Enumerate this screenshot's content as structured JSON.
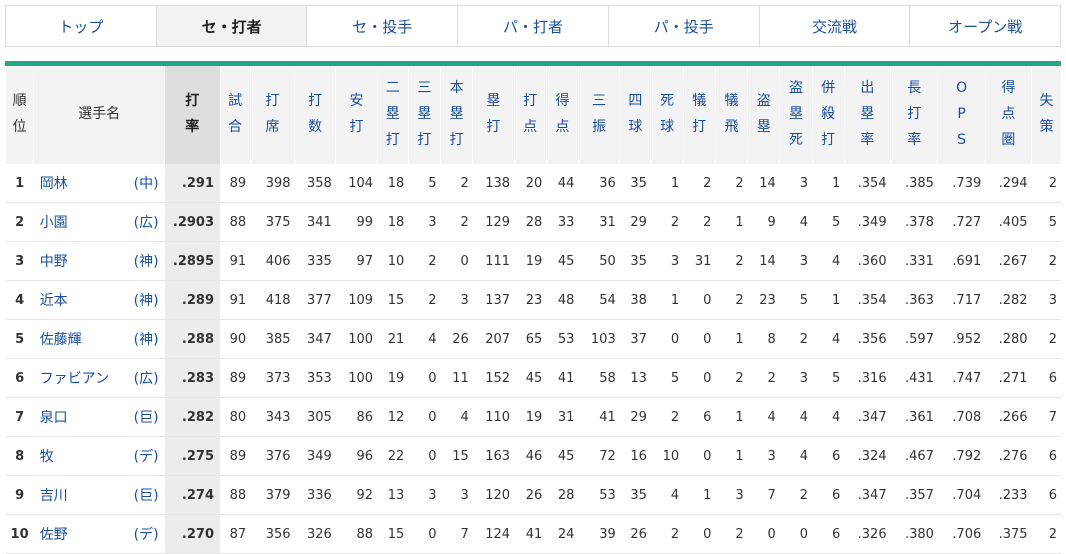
{
  "tabs": [
    {
      "label": "トップ",
      "active": false
    },
    {
      "label": "セ・打者",
      "active": true
    },
    {
      "label": "セ・投手",
      "active": false
    },
    {
      "label": "パ・打者",
      "active": false
    },
    {
      "label": "パ・投手",
      "active": false
    },
    {
      "label": "交流戦",
      "active": false
    },
    {
      "label": "オープン戦",
      "active": false
    }
  ],
  "columns": {
    "rank": "順位",
    "player": "選手名",
    "avg": "打率",
    "games": "試合",
    "pa": "打席",
    "ab": "打数",
    "h": "安打",
    "d": "二塁打",
    "t": "三塁打",
    "hr": "本塁打",
    "tb": "塁打",
    "rbi": "打点",
    "r": "得点",
    "so": "三振",
    "bb": "四球",
    "hbp": "死球",
    "sh": "犠打",
    "sf": "犠飛",
    "sb": "盗塁",
    "cs": "盗塁死",
    "gdp": "併殺打",
    "obp": "出塁率",
    "slg": "長打率",
    "ops": "OPS",
    "risp": "得点圏",
    "e": "失策"
  },
  "rows": [
    {
      "rank": "1",
      "name": "岡林",
      "team": "(中)",
      "avg": ".291",
      "g": "89",
      "pa": "398",
      "ab": "358",
      "h": "104",
      "d": "18",
      "t": "5",
      "hr": "2",
      "tb": "138",
      "rbi": "20",
      "r": "44",
      "so": "36",
      "bb": "35",
      "hbp": "1",
      "sh": "2",
      "sf": "2",
      "sb": "14",
      "cs": "3",
      "gdp": "1",
      "obp": ".354",
      "slg": ".385",
      "ops": ".739",
      "risp": ".294",
      "e": "2"
    },
    {
      "rank": "2",
      "name": "小園",
      "team": "(広)",
      "avg": ".2903",
      "g": "88",
      "pa": "375",
      "ab": "341",
      "h": "99",
      "d": "18",
      "t": "3",
      "hr": "2",
      "tb": "129",
      "rbi": "28",
      "r": "33",
      "so": "31",
      "bb": "29",
      "hbp": "2",
      "sh": "2",
      "sf": "1",
      "sb": "9",
      "cs": "4",
      "gdp": "5",
      "obp": ".349",
      "slg": ".378",
      "ops": ".727",
      "risp": ".405",
      "e": "5"
    },
    {
      "rank": "3",
      "name": "中野",
      "team": "(神)",
      "avg": ".2895",
      "g": "91",
      "pa": "406",
      "ab": "335",
      "h": "97",
      "d": "10",
      "t": "2",
      "hr": "0",
      "tb": "111",
      "rbi": "19",
      "r": "45",
      "so": "50",
      "bb": "35",
      "hbp": "3",
      "sh": "31",
      "sf": "2",
      "sb": "14",
      "cs": "3",
      "gdp": "4",
      "obp": ".360",
      "slg": ".331",
      "ops": ".691",
      "risp": ".267",
      "e": "2"
    },
    {
      "rank": "4",
      "name": "近本",
      "team": "(神)",
      "avg": ".289",
      "g": "91",
      "pa": "418",
      "ab": "377",
      "h": "109",
      "d": "15",
      "t": "2",
      "hr": "3",
      "tb": "137",
      "rbi": "23",
      "r": "48",
      "so": "54",
      "bb": "38",
      "hbp": "1",
      "sh": "0",
      "sf": "2",
      "sb": "23",
      "cs": "5",
      "gdp": "1",
      "obp": ".354",
      "slg": ".363",
      "ops": ".717",
      "risp": ".282",
      "e": "3"
    },
    {
      "rank": "5",
      "name": "佐藤輝",
      "team": "(神)",
      "avg": ".288",
      "g": "90",
      "pa": "385",
      "ab": "347",
      "h": "100",
      "d": "21",
      "t": "4",
      "hr": "26",
      "tb": "207",
      "rbi": "65",
      "r": "53",
      "so": "103",
      "bb": "37",
      "hbp": "0",
      "sh": "0",
      "sf": "1",
      "sb": "8",
      "cs": "2",
      "gdp": "4",
      "obp": ".356",
      "slg": ".597",
      "ops": ".952",
      "risp": ".280",
      "e": "2"
    },
    {
      "rank": "6",
      "name": "ファビアン",
      "team": "(広)",
      "avg": ".283",
      "g": "89",
      "pa": "373",
      "ab": "353",
      "h": "100",
      "d": "19",
      "t": "0",
      "hr": "11",
      "tb": "152",
      "rbi": "45",
      "r": "41",
      "so": "58",
      "bb": "13",
      "hbp": "5",
      "sh": "0",
      "sf": "2",
      "sb": "2",
      "cs": "3",
      "gdp": "5",
      "obp": ".316",
      "slg": ".431",
      "ops": ".747",
      "risp": ".271",
      "e": "6"
    },
    {
      "rank": "7",
      "name": "泉口",
      "team": "(巨)",
      "avg": ".282",
      "g": "80",
      "pa": "343",
      "ab": "305",
      "h": "86",
      "d": "12",
      "t": "0",
      "hr": "4",
      "tb": "110",
      "rbi": "19",
      "r": "31",
      "so": "41",
      "bb": "29",
      "hbp": "2",
      "sh": "6",
      "sf": "1",
      "sb": "4",
      "cs": "4",
      "gdp": "4",
      "obp": ".347",
      "slg": ".361",
      "ops": ".708",
      "risp": ".266",
      "e": "7"
    },
    {
      "rank": "8",
      "name": "牧",
      "team": "(デ)",
      "avg": ".275",
      "g": "89",
      "pa": "376",
      "ab": "349",
      "h": "96",
      "d": "22",
      "t": "0",
      "hr": "15",
      "tb": "163",
      "rbi": "46",
      "r": "45",
      "so": "72",
      "bb": "16",
      "hbp": "10",
      "sh": "0",
      "sf": "1",
      "sb": "3",
      "cs": "4",
      "gdp": "6",
      "obp": ".324",
      "slg": ".467",
      "ops": ".792",
      "risp": ".276",
      "e": "6"
    },
    {
      "rank": "9",
      "name": "吉川",
      "team": "(巨)",
      "avg": ".274",
      "g": "88",
      "pa": "379",
      "ab": "336",
      "h": "92",
      "d": "13",
      "t": "3",
      "hr": "3",
      "tb": "120",
      "rbi": "26",
      "r": "28",
      "so": "53",
      "bb": "35",
      "hbp": "4",
      "sh": "1",
      "sf": "3",
      "sb": "7",
      "cs": "2",
      "gdp": "6",
      "obp": ".347",
      "slg": ".357",
      "ops": ".704",
      "risp": ".233",
      "e": "6"
    },
    {
      "rank": "10",
      "name": "佐野",
      "team": "(デ)",
      "avg": ".270",
      "g": "87",
      "pa": "356",
      "ab": "326",
      "h": "88",
      "d": "15",
      "t": "0",
      "hr": "7",
      "tb": "124",
      "rbi": "41",
      "r": "24",
      "so": "39",
      "bb": "26",
      "hbp": "2",
      "sh": "0",
      "sf": "2",
      "sb": "0",
      "cs": "0",
      "gdp": "6",
      "obp": ".326",
      "slg": ".380",
      "ops": ".706",
      "risp": ".375",
      "e": "2"
    }
  ]
}
